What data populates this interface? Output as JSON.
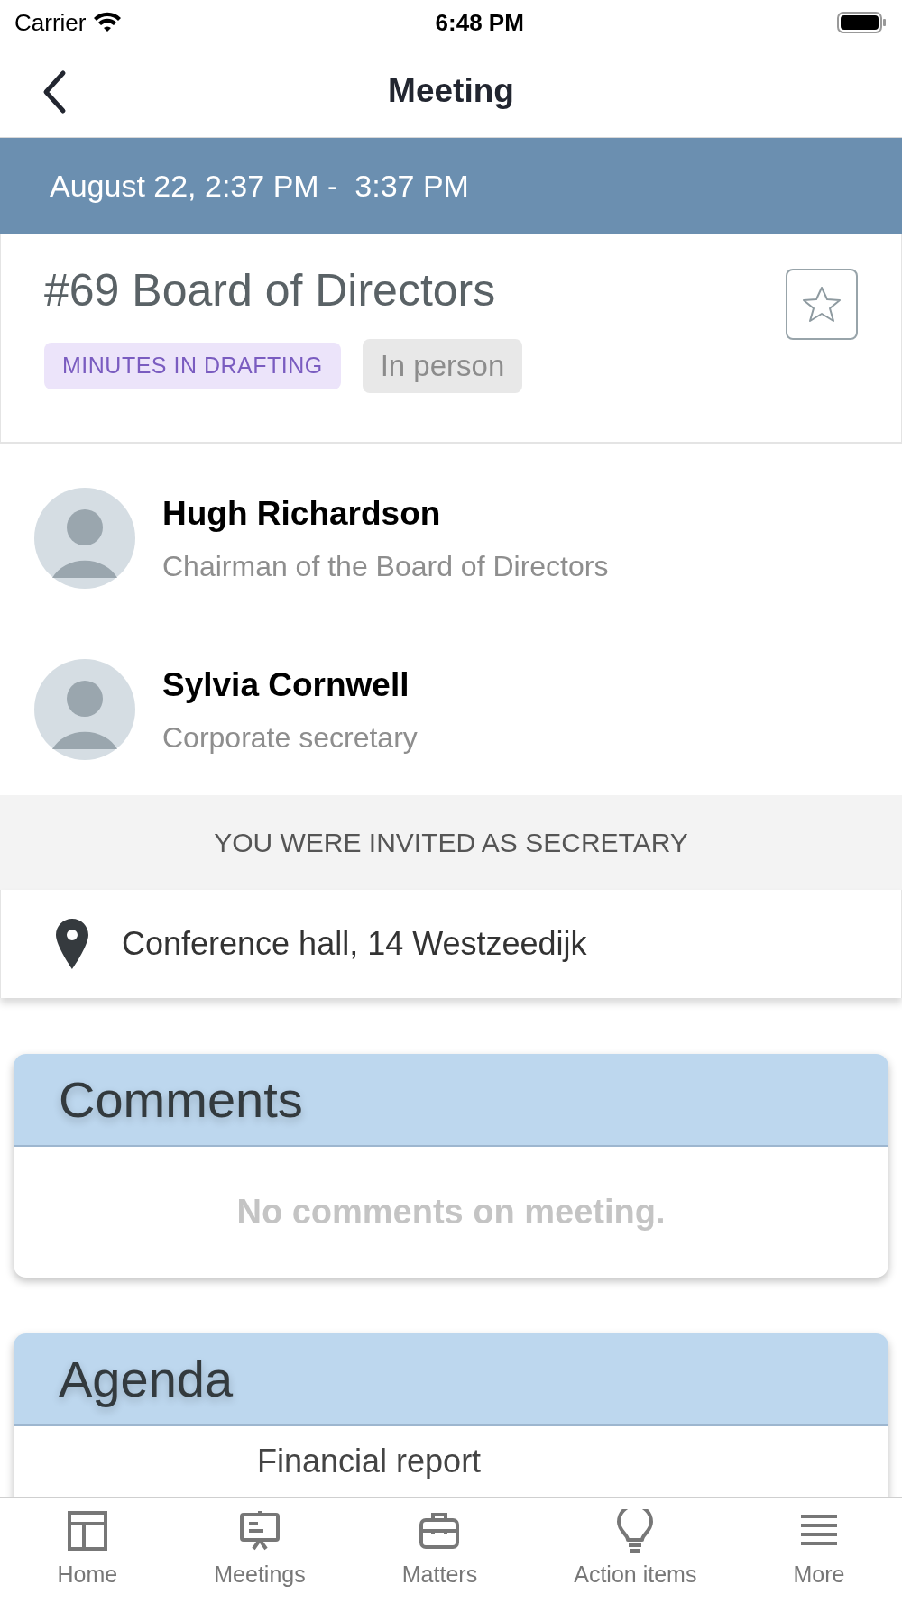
{
  "status_bar": {
    "carrier": "Carrier",
    "time": "6:48 PM"
  },
  "nav": {
    "title": "Meeting"
  },
  "date_range": "August 22, 2:37 PM -  3:37 PM",
  "meeting": {
    "title": "#69 Board of Directors",
    "starred": false,
    "badges": [
      {
        "kind": "status",
        "label": "MINUTES IN DRAFTING"
      },
      {
        "kind": "type",
        "label": "In person"
      }
    ]
  },
  "people": [
    {
      "name": "Hugh Richardson",
      "role": "Chairman of the Board of Directors"
    },
    {
      "name": "Sylvia Cornwell",
      "role": "Corporate secretary"
    }
  ],
  "invitation": "YOU WERE INVITED AS SECRETARY",
  "location": "Conference hall, 14 Westzeedijk",
  "comments": {
    "title": "Comments",
    "empty_text": "No comments on meeting."
  },
  "agenda": {
    "title": "Agenda",
    "items": [
      "Financial report"
    ]
  },
  "tab_bar": [
    {
      "kind": "home",
      "label": "Home"
    },
    {
      "kind": "meetings",
      "label": "Meetings"
    },
    {
      "kind": "matters",
      "label": "Matters"
    },
    {
      "kind": "actions",
      "label": "Action items"
    },
    {
      "kind": "more",
      "label": "More"
    }
  ]
}
